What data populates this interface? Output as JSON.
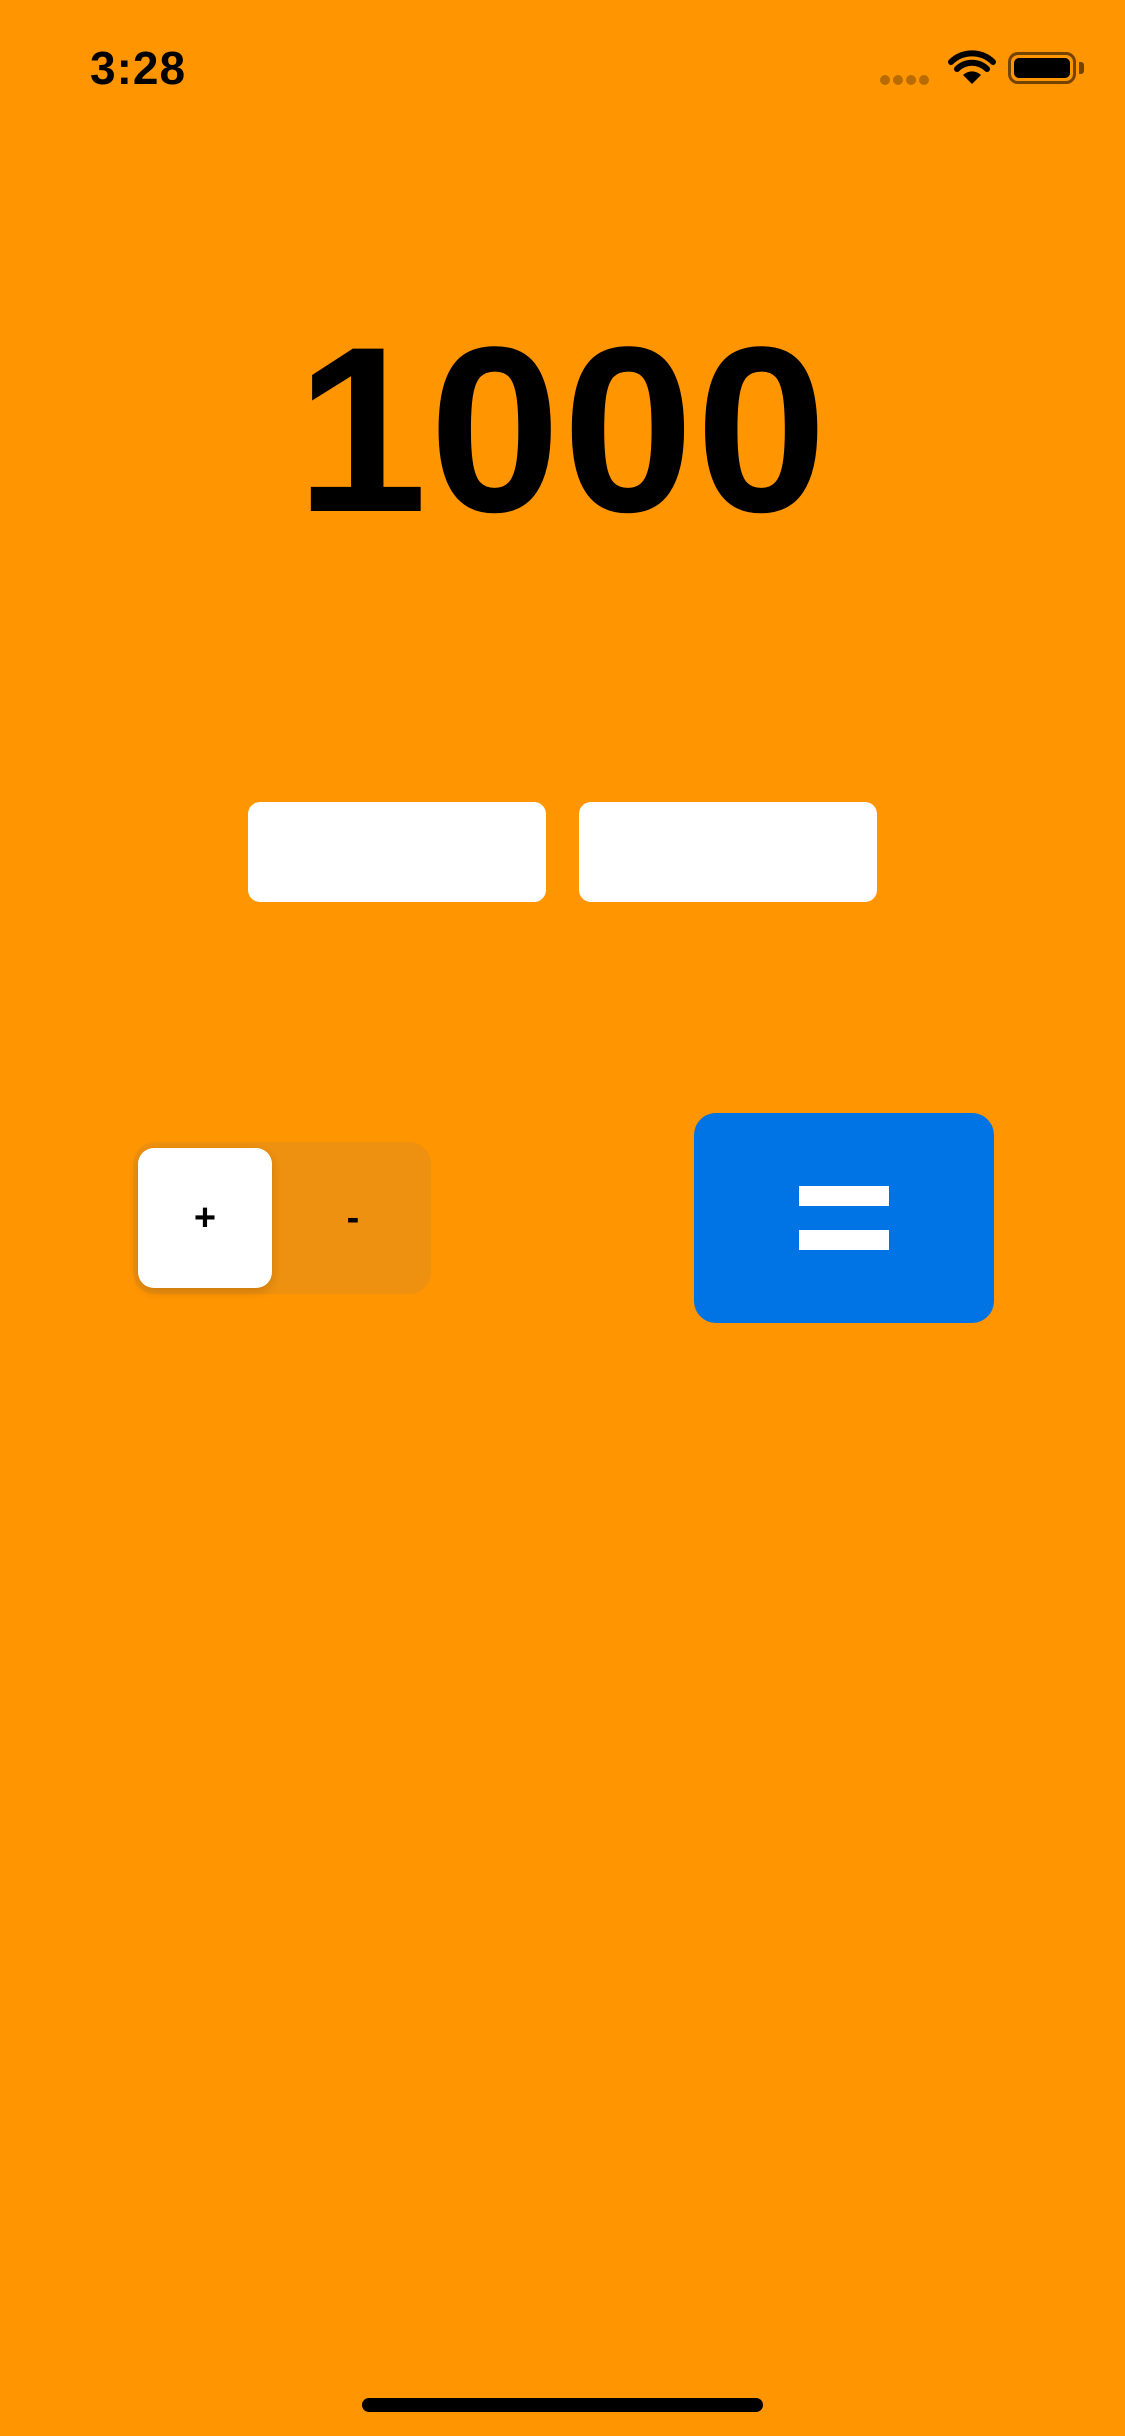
{
  "status_bar": {
    "time": "3:28",
    "icons": [
      "signal-icon",
      "wifi-icon",
      "battery-icon"
    ]
  },
  "calculator": {
    "result": "1000",
    "input_a": {
      "value": "",
      "placeholder": ""
    },
    "input_b": {
      "value": "",
      "placeholder": ""
    },
    "operator_control": {
      "options": [
        "+",
        "-"
      ],
      "selected": "+"
    },
    "equals_button": {
      "icon": "equals-icon"
    }
  },
  "colors": {
    "background": "#FF9500",
    "accent": "#0074E4",
    "text": "#000000",
    "surface": "#FFFFFF"
  }
}
